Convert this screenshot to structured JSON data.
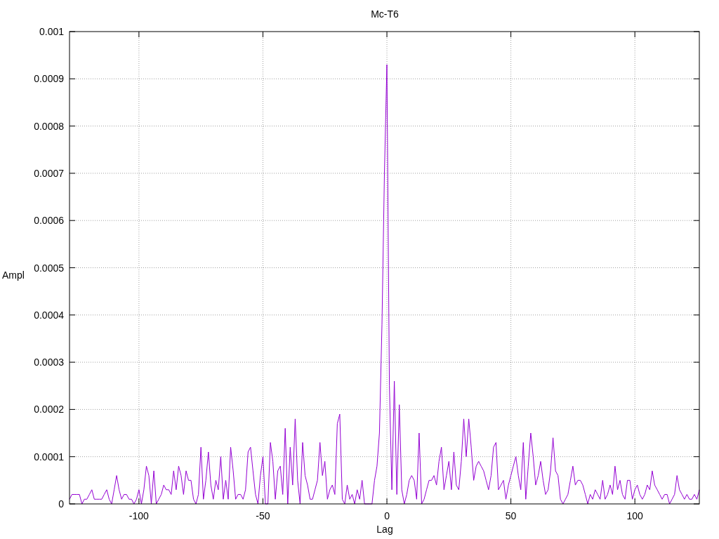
{
  "chart_data": {
    "type": "line",
    "grid": true,
    "title": "Mc-T6",
    "xlabel": "Lag",
    "ylabel": "Ampl",
    "xlim": [
      -128,
      126
    ],
    "ylim": [
      0,
      0.001
    ],
    "xticks": [
      -100,
      -50,
      0,
      50,
      100
    ],
    "yticks": [
      0,
      0.0001,
      0.0002,
      0.0003,
      0.0004,
      0.0005,
      0.0006,
      0.0007,
      0.0008,
      0.0009,
      0.001
    ],
    "x": [
      -128,
      -127,
      -126,
      -125,
      -124,
      -123,
      -122,
      -121,
      -120,
      -119,
      -118,
      -117,
      -116,
      -115,
      -114,
      -113,
      -112,
      -111,
      -110,
      -109,
      -108,
      -107,
      -106,
      -105,
      -104,
      -103,
      -102,
      -101,
      -100,
      -99,
      -98,
      -97,
      -96,
      -95,
      -94,
      -93,
      -92,
      -91,
      -90,
      -89,
      -88,
      -87,
      -86,
      -85,
      -84,
      -83,
      -82,
      -81,
      -80,
      -79,
      -78,
      -77,
      -76,
      -75,
      -74,
      -73,
      -72,
      -71,
      -70,
      -69,
      -68,
      -67,
      -66,
      -65,
      -64,
      -63,
      -62,
      -61,
      -60,
      -59,
      -58,
      -57,
      -56,
      -55,
      -54,
      -53,
      -52,
      -51,
      -50,
      -49,
      -48,
      -47,
      -46,
      -45,
      -44,
      -43,
      -42,
      -41,
      -40,
      -39,
      -38,
      -37,
      -36,
      -35,
      -34,
      -33,
      -32,
      -31,
      -30,
      -29,
      -28,
      -27,
      -26,
      -25,
      -24,
      -23,
      -22,
      -21,
      -20,
      -19,
      -18,
      -17,
      -16,
      -15,
      -14,
      -13,
      -12,
      -11,
      -10,
      -9,
      -8,
      -7,
      -6,
      -5,
      -4,
      -3,
      -2,
      -1,
      0,
      1,
      2,
      3,
      4,
      5,
      6,
      7,
      8,
      9,
      10,
      11,
      12,
      13,
      14,
      15,
      16,
      17,
      18,
      19,
      20,
      21,
      22,
      23,
      24,
      25,
      26,
      27,
      28,
      29,
      30,
      31,
      32,
      33,
      34,
      35,
      36,
      37,
      38,
      39,
      40,
      41,
      42,
      43,
      44,
      45,
      46,
      47,
      48,
      49,
      50,
      51,
      52,
      53,
      54,
      55,
      56,
      57,
      58,
      59,
      60,
      61,
      62,
      63,
      64,
      65,
      66,
      67,
      68,
      69,
      70,
      71,
      72,
      73,
      74,
      75,
      76,
      77,
      78,
      79,
      80,
      81,
      82,
      83,
      84,
      85,
      86,
      87,
      88,
      89,
      90,
      91,
      92,
      93,
      94,
      95,
      96,
      97,
      98,
      99,
      100,
      101,
      102,
      103,
      104,
      105,
      106,
      107,
      108,
      109,
      110,
      111,
      112,
      113,
      114,
      115,
      116,
      117,
      118,
      119,
      120,
      121,
      122,
      123,
      124,
      125,
      126
    ],
    "series": [
      {
        "color": "#9400d3",
        "values": [
          1e-05,
          2e-05,
          2e-05,
          2e-05,
          2e-05,
          0,
          1e-05,
          1e-05,
          2e-05,
          3e-05,
          1e-05,
          1e-05,
          1e-05,
          1e-05,
          2e-05,
          3e-05,
          1e-05,
          0,
          3e-05,
          6e-05,
          3e-05,
          1e-05,
          2e-05,
          2e-05,
          1e-05,
          1e-05,
          0,
          1e-05,
          3e-05,
          0,
          3e-05,
          8e-05,
          6e-05,
          0,
          7e-05,
          0,
          1e-05,
          2e-05,
          4e-05,
          3e-05,
          3e-05,
          2e-05,
          7e-05,
          3e-05,
          8e-05,
          6e-05,
          2e-05,
          7e-05,
          5e-05,
          5e-05,
          1e-05,
          0,
          2e-05,
          0.00012,
          1e-05,
          5e-05,
          0.00011,
          4e-05,
          1e-05,
          5e-05,
          3e-05,
          0.0001,
          1e-05,
          5e-05,
          1e-05,
          0.00012,
          7e-05,
          1e-05,
          2e-05,
          2e-05,
          1e-05,
          3e-05,
          0.00011,
          0.00012,
          7e-05,
          2e-05,
          0,
          6e-05,
          0.0001,
          0,
          0,
          0.00013,
          9e-05,
          1e-05,
          7e-05,
          8e-05,
          2e-05,
          0.00016,
          0,
          0.00012,
          4e-05,
          0.00018,
          5e-05,
          0,
          0.00013,
          6e-05,
          4e-05,
          1e-05,
          1e-05,
          3e-05,
          5e-05,
          0.00013,
          6e-05,
          9e-05,
          1e-05,
          3e-05,
          4e-05,
          2e-05,
          0.00017,
          0.00019,
          1e-05,
          0,
          4e-05,
          1e-05,
          2e-05,
          0,
          3e-05,
          1e-05,
          5e-05,
          0,
          0,
          0,
          0,
          5e-05,
          8e-05,
          0.00015,
          0.00038,
          0.0007,
          0.00093,
          0.00025,
          3e-05,
          0.00026,
          2e-05,
          0.00021,
          3e-05,
          0,
          2e-05,
          5e-05,
          6e-05,
          5e-05,
          1e-05,
          0.00015,
          0,
          1e-05,
          3e-05,
          5e-05,
          5e-05,
          6e-05,
          4e-05,
          9e-05,
          0.00012,
          3e-05,
          6e-05,
          9e-05,
          3e-05,
          0.00011,
          4e-05,
          3e-05,
          9e-05,
          0.00018,
          0.0001,
          0.00018,
          0.00012,
          5e-05,
          8e-05,
          9e-05,
          8e-05,
          7e-05,
          5e-05,
          3e-05,
          6e-05,
          0.00012,
          0.00013,
          3e-05,
          4e-05,
          5e-05,
          1e-05,
          4e-05,
          6e-05,
          8e-05,
          0.0001,
          6e-05,
          3e-05,
          0.00013,
          1e-05,
          8e-05,
          0.00015,
          0.0001,
          4e-05,
          6e-05,
          9e-05,
          5e-05,
          2e-05,
          3e-05,
          7e-05,
          0.00014,
          7e-05,
          6e-05,
          1e-05,
          0,
          1e-05,
          2e-05,
          5e-05,
          8e-05,
          4e-05,
          5e-05,
          5e-05,
          4e-05,
          2e-05,
          0,
          2e-05,
          1e-05,
          3e-05,
          2e-05,
          1e-05,
          5e-05,
          1e-05,
          2e-05,
          4e-05,
          2e-05,
          8e-05,
          3e-05,
          5e-05,
          2e-05,
          1e-05,
          5e-05,
          5e-05,
          1e-05,
          3e-05,
          4e-05,
          2e-05,
          1e-05,
          2e-05,
          4e-05,
          3e-05,
          7e-05,
          4e-05,
          3e-05,
          2e-05,
          1e-05,
          2e-05,
          2e-05,
          0,
          1e-05,
          2e-05,
          6e-05,
          3e-05,
          2e-05,
          1e-05,
          2e-05,
          1e-05,
          1e-05,
          2e-05,
          1e-05,
          3e-05
        ]
      }
    ]
  }
}
